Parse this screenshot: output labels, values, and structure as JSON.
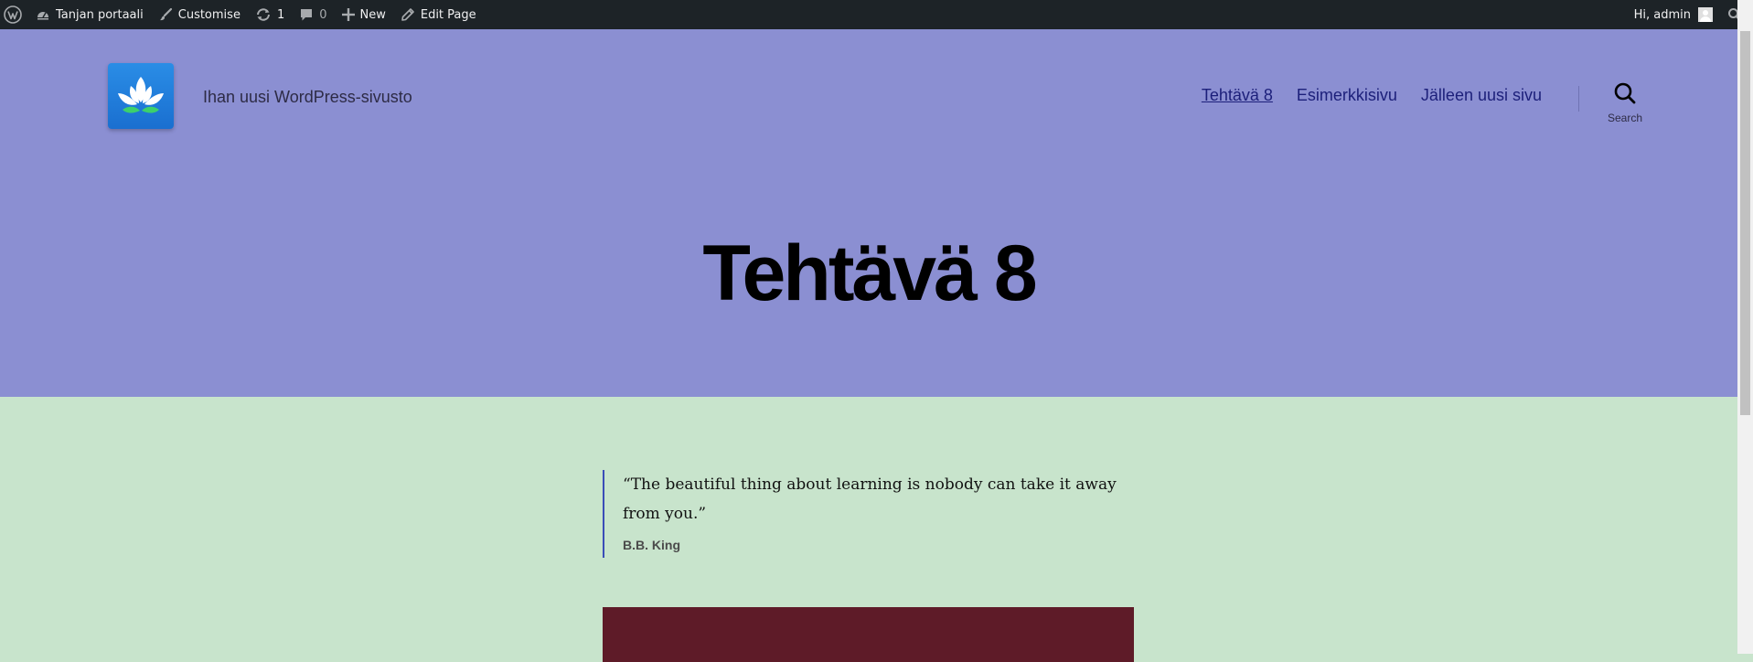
{
  "admin_bar": {
    "site_name": "Tanjan portaali",
    "customise_label": "Customise",
    "updates_count": "1",
    "comments_count": "0",
    "new_label": "New",
    "edit_label": "Edit Page",
    "greeting": "Hi, admin",
    "icons": {
      "wp": "wordpress-logo-icon",
      "site": "dashboard-icon",
      "customise": "paintbrush-icon",
      "updates": "updates-icon",
      "comments": "comment-icon",
      "new": "plus-icon",
      "edit": "pencil-icon",
      "search": "search-icon"
    }
  },
  "header": {
    "description": "Ihan uusi WordPress-sivusto",
    "logo_icon": "lotus-logo-icon",
    "nav": [
      {
        "label": "Tehtävä 8",
        "current": true
      },
      {
        "label": "Esimerkkisivu",
        "current": false
      },
      {
        "label": "Jälleen uusi sivu",
        "current": false
      }
    ],
    "search_label": "Search"
  },
  "page": {
    "title": "Tehtävä 8"
  },
  "content": {
    "quote_text": "“The beautiful thing about learning is nobody can take it away from you.”",
    "quote_cite": "B.B. King"
  },
  "colors": {
    "admin_bar": "#1d2327",
    "header_bg": "#8b8fd2",
    "content_bg": "#c8e4cc",
    "nav_link": "#1c1f7a",
    "quote_border": "#3a4db8",
    "cover_block": "#5e1b28",
    "logo_blue": "#2a8de6"
  }
}
